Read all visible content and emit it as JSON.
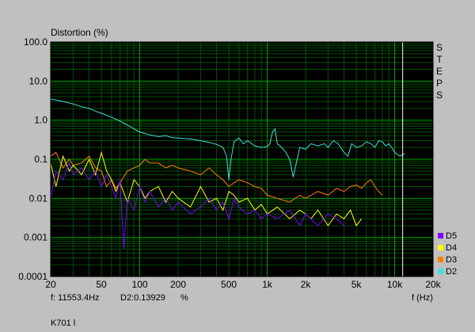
{
  "chart_data": {
    "type": "line",
    "ylabel": "Distortion (%)",
    "xlabel": "f (Hz)",
    "x_scale": "log",
    "y_scale": "log",
    "xlim": [
      20,
      20000
    ],
    "ylim": [
      0.0001,
      100
    ],
    "x_ticks": [
      20,
      50,
      100,
      200,
      500,
      1000,
      2000,
      5000,
      10000,
      20000
    ],
    "x_tick_labels": [
      "20",
      "50",
      "100",
      "200",
      "500",
      "1k",
      "2k",
      "5k",
      "10k",
      "20k"
    ],
    "y_ticks": [
      0.0001,
      0.001,
      0.01,
      0.1,
      1,
      10,
      100
    ],
    "y_tick_labels": [
      "0.0001",
      "0.001",
      "0.01",
      "0.1",
      "1.0",
      "10.0",
      "100.0"
    ],
    "grid": true,
    "background": "#000000",
    "grid_major_color": "#00a000",
    "grid_minor_color": "#005000",
    "cursor_x": 11553.4,
    "cursor_color": "#ffffc0",
    "legend_position": "bottom-right",
    "series": [
      {
        "name": "D2",
        "color": "#40e0e0",
        "x": [
          20,
          25,
          30,
          35,
          40,
          45,
          50,
          60,
          70,
          80,
          90,
          100,
          120,
          140,
          160,
          180,
          200,
          250,
          300,
          350,
          400,
          450,
          480,
          500,
          520,
          550,
          600,
          650,
          700,
          800,
          900,
          1000,
          1050,
          1100,
          1150,
          1200,
          1300,
          1400,
          1500,
          1600,
          1800,
          2000,
          2200,
          2500,
          2800,
          3000,
          3300,
          3600,
          4000,
          4300,
          4600,
          5000,
          5500,
          6000,
          6500,
          7000,
          7500,
          8000,
          8500,
          9000,
          9500,
          10000,
          11000,
          12000
        ],
        "y": [
          3.5,
          3.0,
          2.6,
          2.2,
          2.0,
          1.7,
          1.5,
          1.2,
          0.95,
          0.75,
          0.6,
          0.5,
          0.42,
          0.38,
          0.4,
          0.36,
          0.35,
          0.33,
          0.3,
          0.27,
          0.24,
          0.2,
          0.12,
          0.03,
          0.1,
          0.28,
          0.35,
          0.25,
          0.3,
          0.22,
          0.2,
          0.21,
          0.25,
          0.5,
          0.6,
          0.25,
          0.2,
          0.15,
          0.1,
          0.035,
          0.2,
          0.18,
          0.25,
          0.22,
          0.25,
          0.2,
          0.3,
          0.25,
          0.15,
          0.12,
          0.25,
          0.2,
          0.22,
          0.28,
          0.25,
          0.2,
          0.3,
          0.28,
          0.22,
          0.25,
          0.2,
          0.15,
          0.12,
          0.14
        ]
      },
      {
        "name": "D3",
        "color": "#ff8000",
        "x": [
          20,
          22,
          25,
          28,
          30,
          35,
          40,
          45,
          50,
          55,
          60,
          65,
          70,
          80,
          90,
          100,
          110,
          120,
          140,
          160,
          180,
          200,
          250,
          300,
          350,
          400,
          450,
          500,
          550,
          600,
          700,
          800,
          900,
          1000,
          1200,
          1500,
          1800,
          2000,
          2500,
          3000,
          3500,
          4000,
          4500,
          5000,
          5500,
          6000,
          6500,
          7000,
          7500,
          8000
        ],
        "y": [
          0.12,
          0.15,
          0.06,
          0.1,
          0.07,
          0.08,
          0.12,
          0.06,
          0.05,
          0.02,
          0.03,
          0.018,
          0.025,
          0.05,
          0.06,
          0.07,
          0.1,
          0.08,
          0.08,
          0.06,
          0.07,
          0.06,
          0.05,
          0.04,
          0.06,
          0.04,
          0.03,
          0.02,
          0.025,
          0.03,
          0.025,
          0.02,
          0.018,
          0.012,
          0.01,
          0.008,
          0.012,
          0.01,
          0.015,
          0.012,
          0.018,
          0.015,
          0.02,
          0.022,
          0.018,
          0.025,
          0.03,
          0.02,
          0.015,
          0.012
        ]
      },
      {
        "name": "D4",
        "color": "#ffff00",
        "x": [
          20,
          22,
          25,
          28,
          30,
          35,
          40,
          45,
          50,
          55,
          60,
          65,
          70,
          80,
          90,
          100,
          110,
          120,
          140,
          160,
          180,
          200,
          250,
          300,
          350,
          400,
          450,
          500,
          550,
          600,
          700,
          800,
          900,
          1000,
          1200,
          1500,
          1800,
          2000,
          2200,
          2500,
          3000,
          3500,
          4000,
          4500,
          5000,
          5500
        ],
        "y": [
          0.08,
          0.02,
          0.12,
          0.05,
          0.07,
          0.04,
          0.1,
          0.04,
          0.15,
          0.05,
          0.03,
          0.015,
          0.025,
          0.008,
          0.03,
          0.02,
          0.01,
          0.015,
          0.02,
          0.008,
          0.015,
          0.01,
          0.006,
          0.02,
          0.008,
          0.01,
          0.005,
          0.015,
          0.012,
          0.008,
          0.01,
          0.005,
          0.007,
          0.004,
          0.006,
          0.003,
          0.005,
          0.004,
          0.003,
          0.005,
          0.002,
          0.004,
          0.003,
          0.005,
          0.002,
          0.003
        ]
      },
      {
        "name": "D5",
        "color": "#8000ff",
        "x": [
          20,
          22,
          25,
          28,
          30,
          35,
          40,
          45,
          50,
          55,
          60,
          65,
          70,
          75,
          80,
          90,
          100,
          110,
          120,
          140,
          160,
          180,
          200,
          250,
          300,
          350,
          400,
          450,
          500,
          550,
          600,
          700,
          800,
          900,
          1000,
          1200,
          1500,
          1800,
          2000,
          2200,
          2500,
          3000,
          3500,
          4000
        ],
        "y": [
          0.01,
          0.05,
          0.03,
          0.08,
          0.04,
          0.06,
          0.03,
          0.05,
          0.02,
          0.04,
          0.02,
          0.01,
          0.03,
          0.0005,
          0.01,
          0.005,
          0.02,
          0.008,
          0.015,
          0.006,
          0.01,
          0.005,
          0.008,
          0.004,
          0.006,
          0.01,
          0.005,
          0.008,
          0.003,
          0.01,
          0.006,
          0.004,
          0.005,
          0.003,
          0.004,
          0.003,
          0.005,
          0.002,
          0.004,
          0.003,
          0.002,
          0.004,
          0.003,
          0.002
        ]
      }
    ]
  },
  "readout": {
    "freq_text": "f: 11553.4Hz",
    "value_text": "D2:0.13929",
    "unit_text": "%"
  },
  "side_label": [
    "S",
    "T",
    "E",
    "P",
    "S"
  ],
  "legend": [
    {
      "label": "D5",
      "color": "#8000ff"
    },
    {
      "label": "D4",
      "color": "#ffff00"
    },
    {
      "label": "D3",
      "color": "#ff8000"
    },
    {
      "label": "D2",
      "color": "#40e0e0"
    }
  ],
  "caption": "K701 l"
}
